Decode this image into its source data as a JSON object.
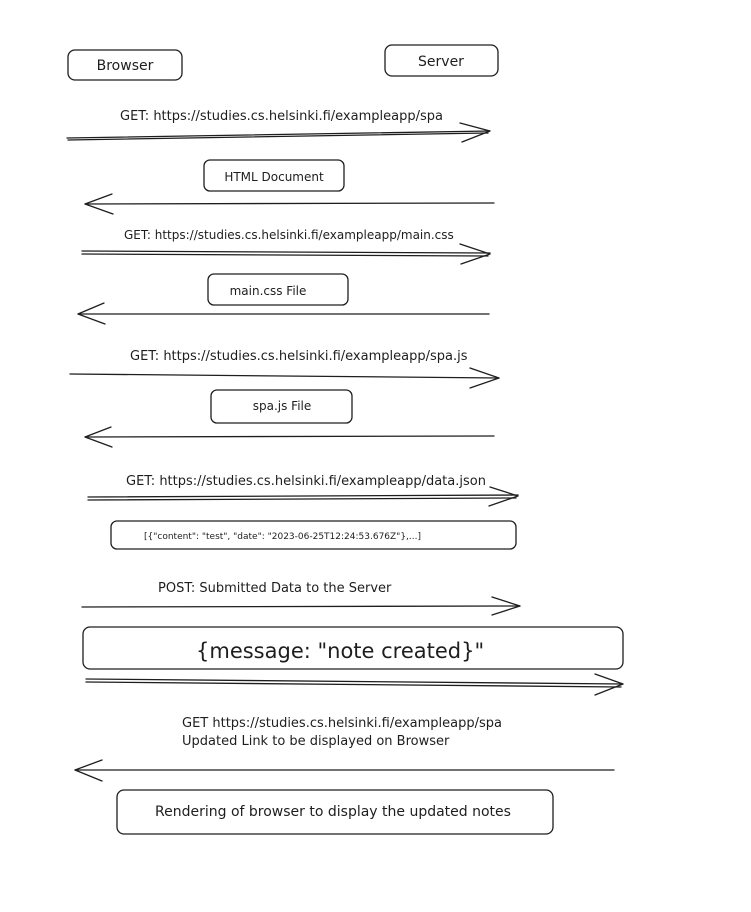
{
  "actors": {
    "browser": "Browser",
    "server": "Server"
  },
  "messages": [
    {
      "label": "GET:  https://studies.cs.helsinki.fi/exampleapp/spa"
    },
    {
      "label": "HTML Document"
    },
    {
      "label": "GET: https://studies.cs.helsinki.fi/exampleapp/main.css"
    },
    {
      "label": "main.css File"
    },
    {
      "label": "GET: https://studies.cs.helsinki.fi/exampleapp/spa.js"
    },
    {
      "label": "spa.js File"
    },
    {
      "label": "GET:  https://studies.cs.helsinki.fi/exampleapp/data.json"
    },
    {
      "label": "[{\"content\": \"test\", \"date\": \"2023-06-25T12:24:53.676Z\"},...]"
    },
    {
      "label": "POST:  Submitted Data to the Server"
    },
    {
      "label": "{message: \"note created}\""
    },
    {
      "label": "GET   https://studies.cs.helsinki.fi/exampleapp/spa",
      "label2": "Updated Link to be displayed on Browser"
    },
    {
      "label": "Rendering of browser to display the updated notes"
    }
  ]
}
